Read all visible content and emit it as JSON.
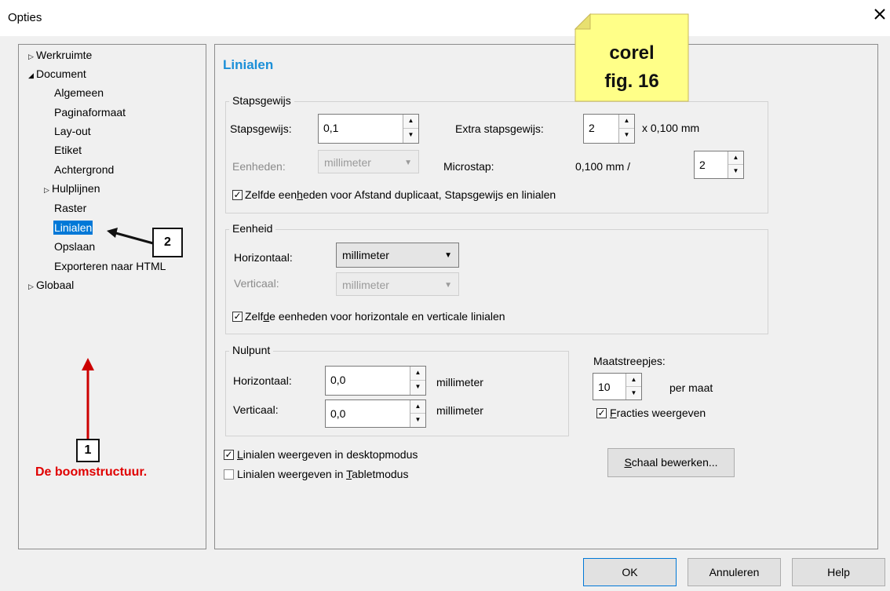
{
  "window": {
    "title": "Opties",
    "close_icon": "close-icon"
  },
  "tree": {
    "items": [
      {
        "label": "Werkruimte",
        "expander": "collapsed"
      },
      {
        "label": "Document",
        "expander": "expanded"
      },
      {
        "label": "Algemeen"
      },
      {
        "label": "Paginaformaat"
      },
      {
        "label": "Lay-out"
      },
      {
        "label": "Etiket"
      },
      {
        "label": "Achtergrond"
      },
      {
        "label": "Hulplijnen",
        "expander": "collapsed"
      },
      {
        "label": "Raster"
      },
      {
        "label": "Linialen",
        "selected": true
      },
      {
        "label": "Opslaan"
      },
      {
        "label": "Exporteren naar HTML"
      },
      {
        "label": "Globaal",
        "expander": "collapsed"
      }
    ]
  },
  "page": {
    "heading": "Linialen"
  },
  "stapsgewijs": {
    "legend": "Stapsgewijs",
    "step_label": "Stapsgewijs:",
    "step_value": "0,1",
    "extra_label": "Extra stapsgewijs:",
    "extra_value": "2",
    "extra_unit": "x 0,100 mm",
    "units_label": "Eenheden:",
    "units_value": "millimeter",
    "micro_label": "Microstap:",
    "micro_readout": "0,100 mm /",
    "micro_value": "2",
    "same_units_pre": "Zelfde een",
    "same_units_u": "h",
    "same_units_post": "eden voor Afstand duplicaat, Stapsgewijs en linialen",
    "same_units_checked": true
  },
  "eenheid": {
    "legend": "Eenheid",
    "horizontal_label": "Horizontaal:",
    "horizontal_value": "millimeter",
    "vertical_label": "Verticaal:",
    "vertical_value": "millimeter",
    "same_pre": "Zelf",
    "same_u": "d",
    "same_post": "e eenheden voor horizontale en verticale linialen",
    "same_checked": true
  },
  "nulpunt": {
    "legend": "Nulpunt",
    "horizontal_label": "Horizontaal:",
    "horizontal_value": "0,0",
    "horizontal_unit": "millimeter",
    "vertical_label": "Verticaal:",
    "vertical_value": "0,0",
    "vertical_unit": "millimeter"
  },
  "maatstreepjes": {
    "label": "Maatstreepjes:",
    "value": "10",
    "unit": "per maat",
    "fractions_u": "F",
    "fractions_post": "racties weergeven",
    "fractions_checked": true
  },
  "display": {
    "desktop_u": "L",
    "desktop_post": "inialen weergeven in desktopmodus",
    "desktop_checked": true,
    "tablet_pre": "Linialen weergeven in ",
    "tablet_u": "T",
    "tablet_post": "abletmodus",
    "tablet_checked": false
  },
  "scale_button": {
    "u": "S",
    "post": "chaal bewerken..."
  },
  "buttons": {
    "ok": "OK",
    "cancel": "Annuleren",
    "help": "Help"
  },
  "annotations": {
    "note_line1": "corel",
    "note_line2": "fig. 16",
    "note_color": "#ffff88",
    "callout1": "1",
    "callout1_caption": "De boomstructuur.",
    "callout2": "2",
    "arrow_red": "#cc0000"
  },
  "colors": {
    "accent": "#0078d7",
    "heading": "#1b8fd8",
    "caption_red": "#e00000"
  }
}
